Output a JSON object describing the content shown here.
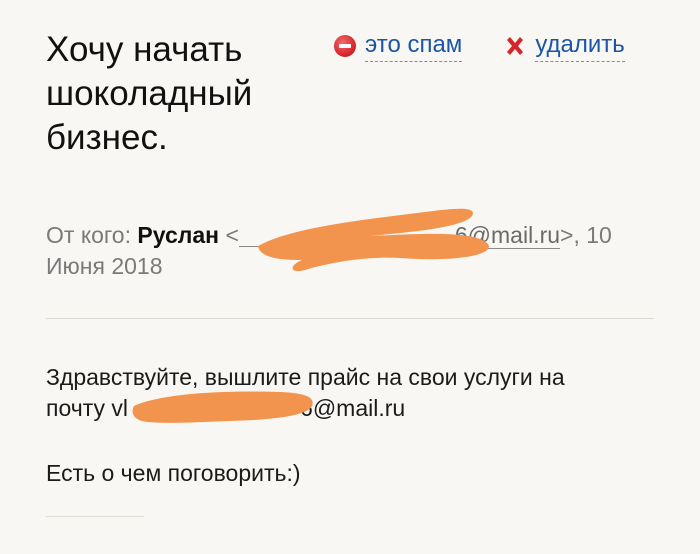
{
  "message": {
    "subject": "Хочу начать шоколадный бизнес.",
    "actions": {
      "spam_label": "это спам",
      "delete_label": "удалить"
    },
    "sender": {
      "from_label": "От кого:",
      "name": "Руслан",
      "open_bracket": "<",
      "email_prefix": "",
      "email_visible": "6@mail.ru",
      "close_and_date": ">, 10 Июня 2018"
    },
    "body": {
      "line1": "Здравствуйте, вышлите прайс на свои услуги на",
      "line2_prefix": "почту vl",
      "line2_suffix": "6@mail.ru",
      "line3": "Есть о чем поговорить:)"
    }
  },
  "colors": {
    "background": "#f8f7f4",
    "link": "#1b56a6",
    "spam_icon": "#d6242a",
    "delete_icon": "#d6242a",
    "redaction": "#f3944e",
    "muted_text": "#7a7a7a"
  },
  "icons": {
    "spam": "minus-circle-icon",
    "delete": "x-cross-icon"
  }
}
